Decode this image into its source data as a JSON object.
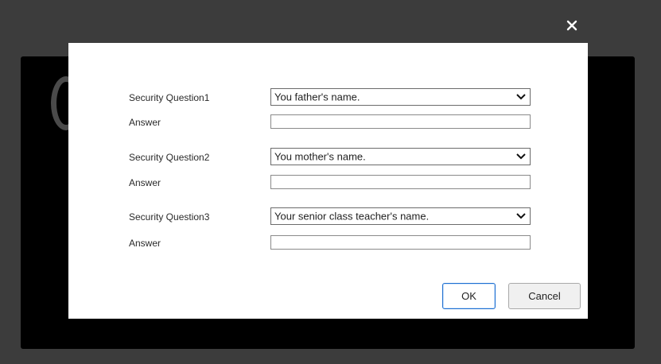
{
  "dialog": {
    "close_symbol": "×",
    "questions": [
      {
        "label": "Security Question1",
        "selected": "You father's name.",
        "answer_label": "Answer",
        "answer_value": ""
      },
      {
        "label": "Security Question2",
        "selected": "You mother's name.",
        "answer_label": "Answer",
        "answer_value": ""
      },
      {
        "label": "Security Question3",
        "selected": "Your senior class teacher's name.",
        "answer_label": "Answer",
        "answer_value": ""
      }
    ],
    "ok_label": "OK",
    "cancel_label": "Cancel"
  },
  "icons": {
    "close": "close-icon",
    "dropdown": "chevron-down-icon",
    "background_logo": "circular-logo"
  },
  "colors": {
    "overlay": "#3c3c3c",
    "background_panel": "#000000",
    "dialog": "#ffffff",
    "ok_border": "#1e6fd0"
  }
}
